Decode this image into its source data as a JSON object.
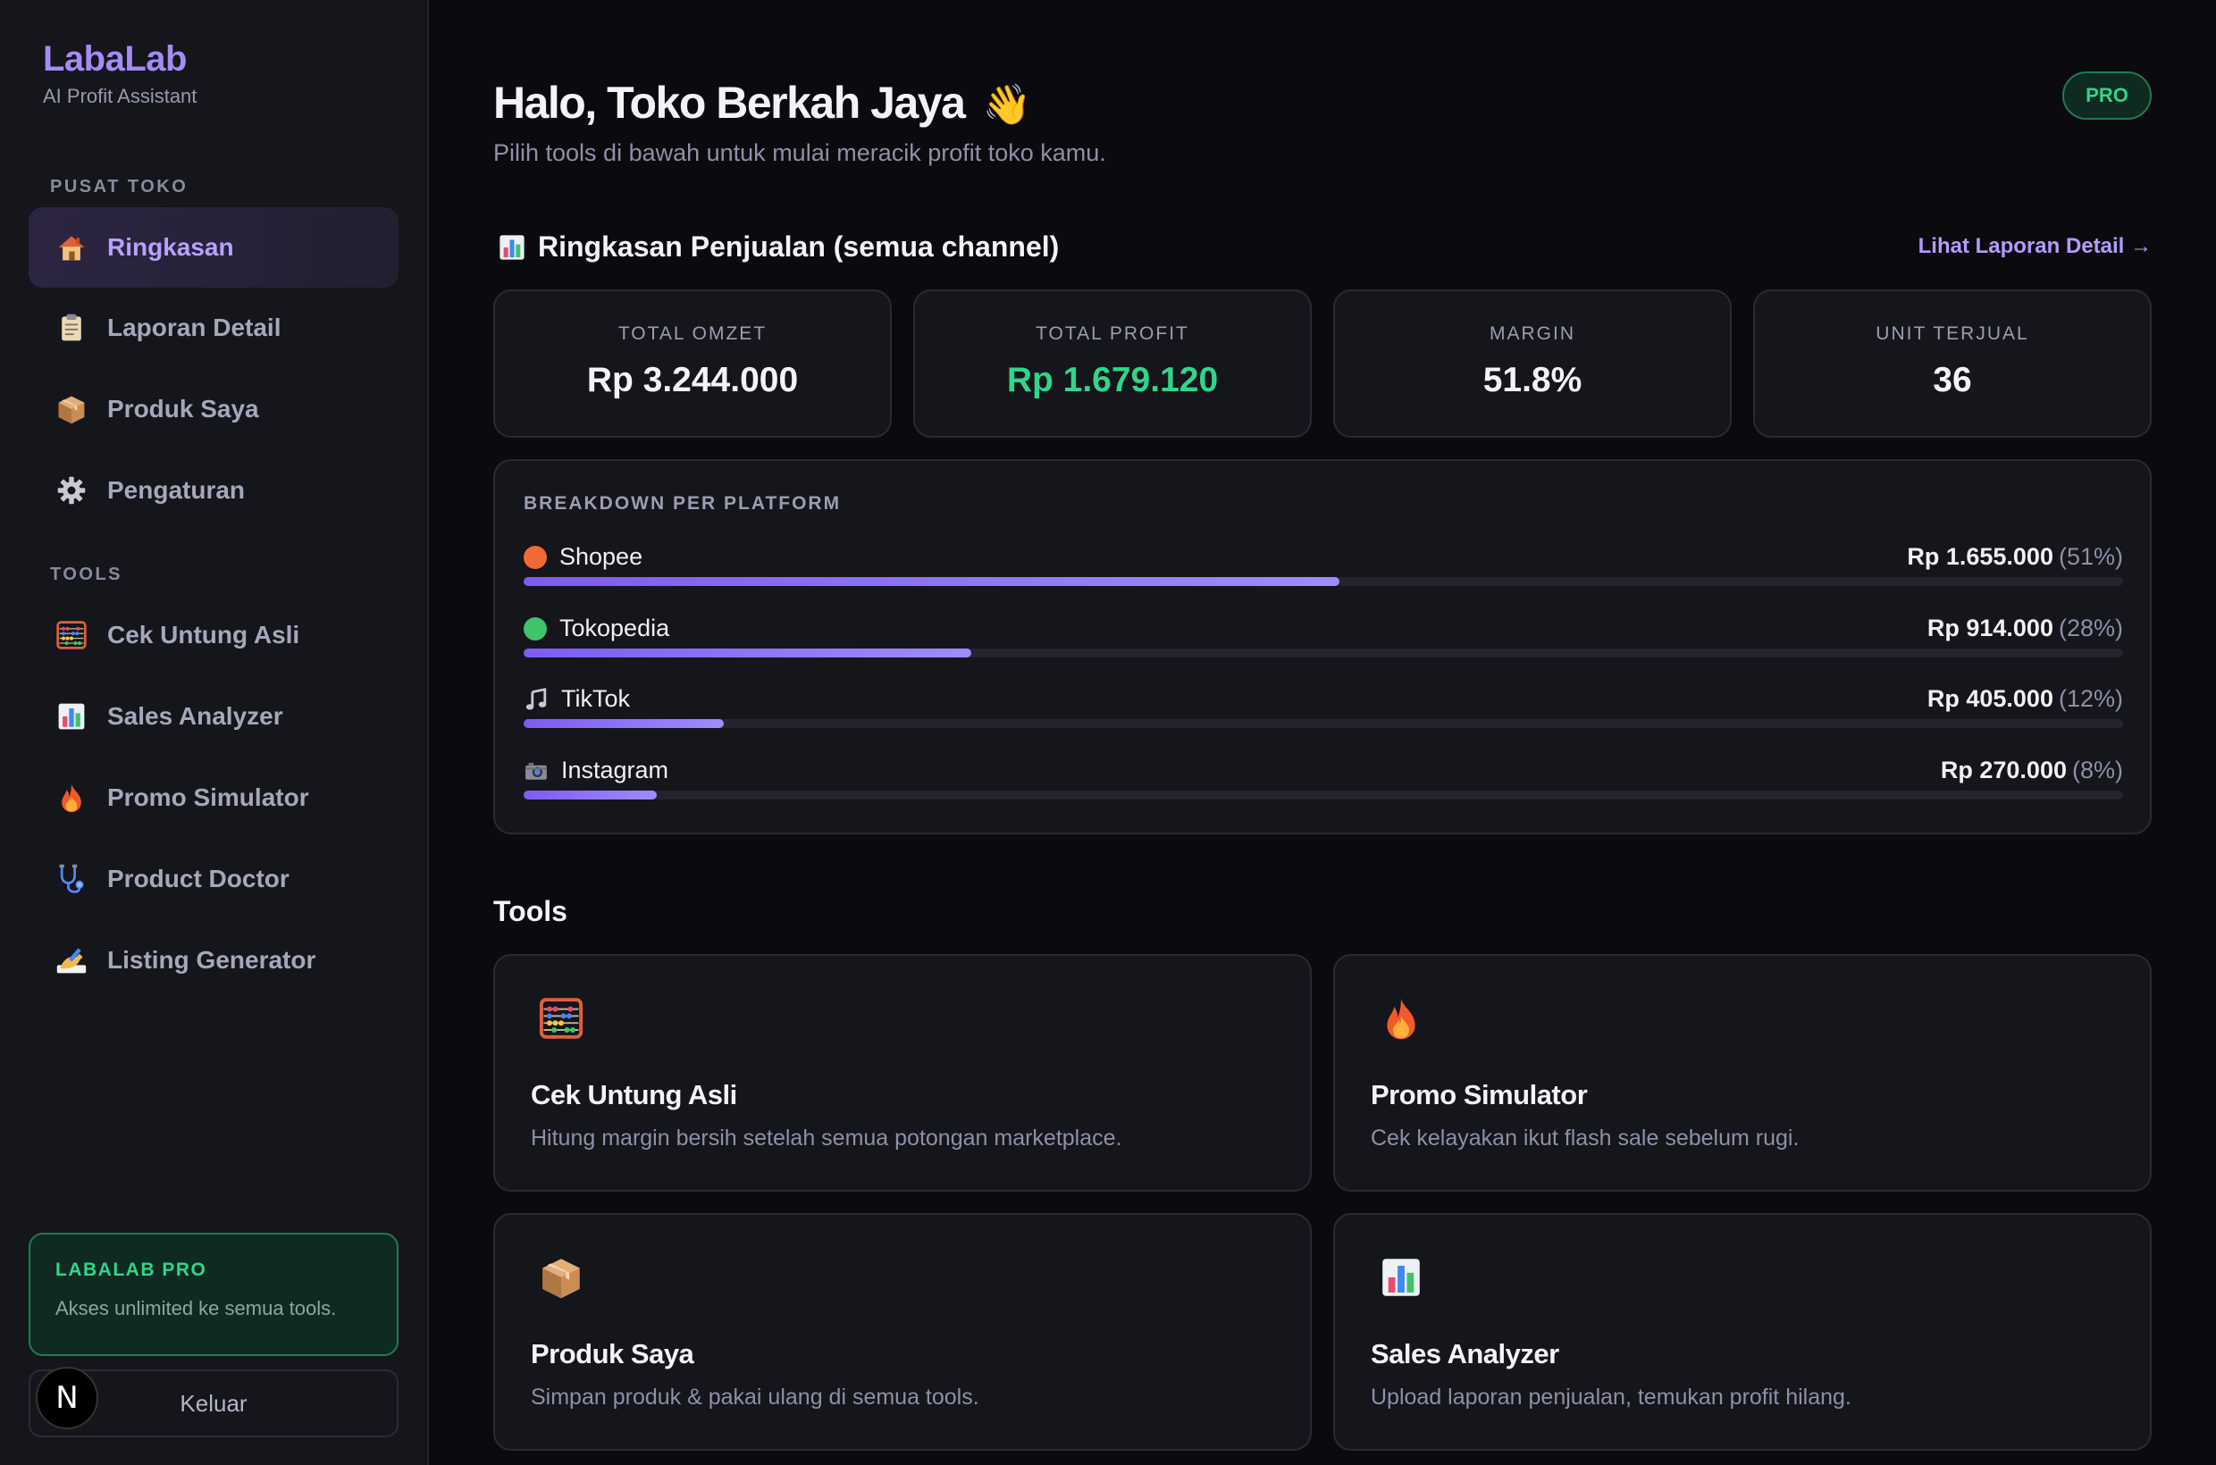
{
  "brand": {
    "name": "LabaLab",
    "subtitle": "AI Profit Assistant"
  },
  "sidebar": {
    "section_store": "PUSAT TOKO",
    "store_items": [
      {
        "label": "Ringkasan",
        "icon": "house-icon",
        "active": true
      },
      {
        "label": "Laporan Detail",
        "icon": "clipboard-icon"
      },
      {
        "label": "Produk Saya",
        "icon": "package-icon"
      },
      {
        "label": "Pengaturan",
        "icon": "gear-icon"
      }
    ],
    "section_tools": "TOOLS",
    "tool_items": [
      {
        "label": "Cek Untung Asli",
        "icon": "abacus-icon"
      },
      {
        "label": "Sales Analyzer",
        "icon": "bar-chart-icon"
      },
      {
        "label": "Promo Simulator",
        "icon": "fire-icon"
      },
      {
        "label": "Product Doctor",
        "icon": "stethoscope-icon"
      },
      {
        "label": "Listing Generator",
        "icon": "writing-hand-icon"
      }
    ],
    "pro_box": {
      "title": "LABALAB PRO",
      "subtitle": "Akses unlimited ke semua tools."
    },
    "logout_label": "Keluar",
    "avatar_letter": "N"
  },
  "header": {
    "greeting": "Halo, Toko Berkah Jaya",
    "greeting_emoji": "👋",
    "subtitle": "Pilih tools di bawah untuk mulai meracik profit toko kamu.",
    "plan_badge": "PRO"
  },
  "summary": {
    "title": "Ringkasan Penjualan (semua channel)",
    "link": "Lihat Laporan Detail →",
    "stats": [
      {
        "label": "TOTAL OMZET",
        "value": "Rp 3.244.000"
      },
      {
        "label": "TOTAL PROFIT",
        "value": "Rp 1.679.120"
      },
      {
        "label": "MARGIN",
        "value": "51.8%"
      },
      {
        "label": "UNIT TERJUAL",
        "value": "36"
      }
    ]
  },
  "breakdown": {
    "title": "BREAKDOWN PER PLATFORM",
    "platforms": [
      {
        "name": "Shopee",
        "amount": "Rp 1.655.000",
        "pct": "(51%)",
        "share": 0.51,
        "color": "#f06a35"
      },
      {
        "name": "Tokopedia",
        "amount": "Rp 914.000",
        "pct": "(28%)",
        "share": 0.28,
        "color": "#3fc46a"
      },
      {
        "name": "TikTok",
        "amount": "Rp 405.000",
        "pct": "(12%)",
        "share": 0.125,
        "icon": "music-note-icon"
      },
      {
        "name": "Instagram",
        "amount": "Rp 270.000",
        "pct": "(8%)",
        "share": 0.083,
        "icon": "camera-icon"
      }
    ]
  },
  "tools": {
    "title": "Tools",
    "cards": [
      {
        "name": "Cek Untung Asli",
        "desc": "Hitung margin bersih setelah semua potongan marketplace.",
        "icon": "abacus-icon"
      },
      {
        "name": "Promo Simulator",
        "desc": "Cek kelayakan ikut flash sale sebelum rugi.",
        "icon": "fire-icon"
      },
      {
        "name": "Produk Saya",
        "desc": "Simpan produk & pakai ulang di semua tools.",
        "icon": "package-icon"
      },
      {
        "name": "Sales Analyzer",
        "desc": "Upload laporan penjualan, temukan profit hilang.",
        "icon": "bar-chart-icon"
      }
    ]
  }
}
